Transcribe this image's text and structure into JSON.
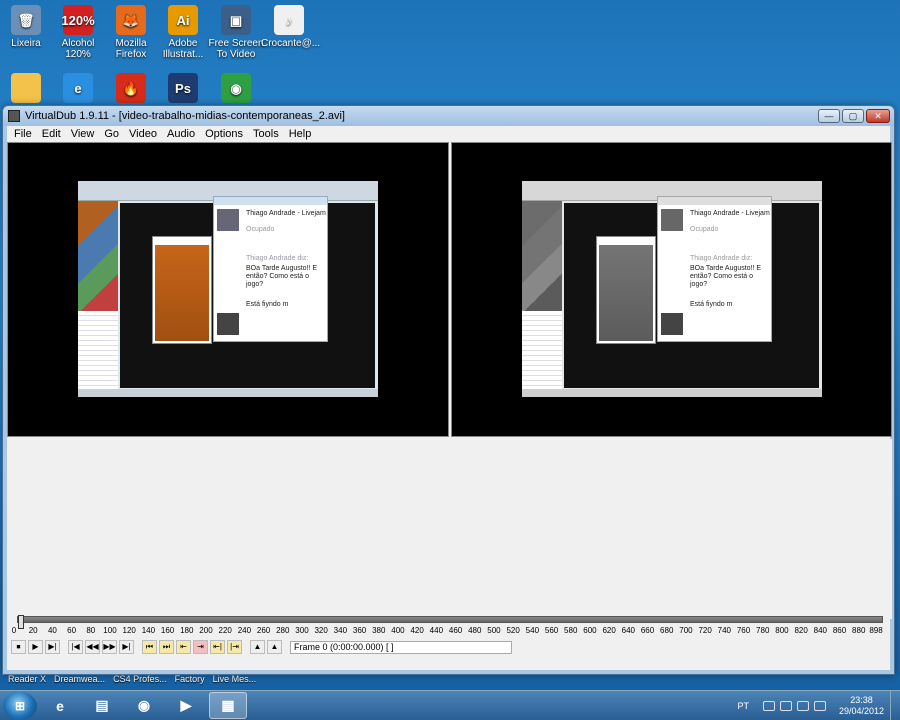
{
  "desktop": {
    "icons": [
      {
        "label": "Lixeira",
        "icon": "recycle-bin-icon",
        "color": "#6c8fb5",
        "glyph": "🗑"
      },
      {
        "label": "Alcohol\n120%",
        "icon": "alcohol-120-icon",
        "color": "#d32020",
        "glyph": "120%"
      },
      {
        "label": "Mozilla\nFirefox",
        "icon": "firefox-icon",
        "color": "#e66a1c",
        "glyph": "🦊"
      },
      {
        "label": "Adobe\nIllustrat...",
        "icon": "illustrator-icon",
        "color": "#e79a00",
        "glyph": "Ai"
      },
      {
        "label": "Free Screen\nTo Video",
        "icon": "screen-video-icon",
        "color": "#3b5f8a",
        "glyph": "▣"
      },
      {
        "label": "Crocante@...",
        "icon": "mp3-file-icon",
        "color": "#f0f0f0",
        "glyph": "♪"
      },
      {
        "label": "",
        "icon": "folder-icon",
        "color": "#f2c24a",
        "glyph": ""
      },
      {
        "label": "",
        "icon": "ie-icon",
        "color": "#2a8fe0",
        "glyph": "e"
      },
      {
        "label": "",
        "icon": "fire-icon",
        "color": "#d62c1a",
        "glyph": "🔥"
      },
      {
        "label": "",
        "icon": "photoshop-icon",
        "color": "#1e3c72",
        "glyph": "Ps"
      },
      {
        "label": "",
        "icon": "chrome-icon",
        "color": "#2ea043",
        "glyph": "◉"
      }
    ]
  },
  "window": {
    "title": "VirtualDub 1.9.11 - [video-trabalho-midias-contemporaneas_2.avi]",
    "buttons": {
      "minimize": "—",
      "maximize": "▢",
      "close": "✕"
    },
    "menu": [
      "File",
      "Edit",
      "View",
      "Go",
      "Video",
      "Audio",
      "Options",
      "Tools",
      "Help"
    ]
  },
  "preview": {
    "chat": {
      "name": "Thiago Andrade - Livejam",
      "status": "Ocupado",
      "sender": "Thiago Andrade diz:",
      "message": "BOa Tarde Augusto!! E então? Como está o jogo?",
      "typing": "Está fiyndo m"
    }
  },
  "timeline": {
    "ticks": [
      "0",
      "20",
      "40",
      "60",
      "80",
      "100",
      "120",
      "140",
      "160",
      "180",
      "200",
      "220",
      "240",
      "260",
      "280",
      "300",
      "320",
      "340",
      "360",
      "380",
      "400",
      "420",
      "440",
      "460",
      "480",
      "500",
      "520",
      "540",
      "560",
      "580",
      "600",
      "620",
      "640",
      "660",
      "680",
      "700",
      "720",
      "740",
      "760",
      "780",
      "800",
      "820",
      "840",
      "860",
      "880",
      "898"
    ],
    "position": 0,
    "max": 898,
    "controls": [
      "⏹",
      "▶",
      "▶|",
      "|◀",
      "◀◀",
      "▶▶",
      "▶|",
      "⏮",
      "⏭",
      "⇤",
      "⇥",
      "⇤|",
      "|⇥",
      "▲",
      "▲"
    ],
    "frame_label": "Frame 0 (0:00:00.000) [ ]"
  },
  "taskbar": {
    "ghost_labels": [
      "Reader X",
      "Dreamwea...",
      "CS4 Profes...",
      "Factory",
      "Live Mes..."
    ],
    "items": [
      {
        "icon": "ie-icon",
        "glyph": "e"
      },
      {
        "icon": "folder-icon",
        "glyph": "▤"
      },
      {
        "icon": "chrome-icon",
        "glyph": "◉"
      },
      {
        "icon": "media-player-icon",
        "glyph": "▶"
      },
      {
        "icon": "virtualdub-icon",
        "glyph": "▦"
      }
    ],
    "language": "PT",
    "time": "23:38",
    "date": "29/04/2012"
  }
}
